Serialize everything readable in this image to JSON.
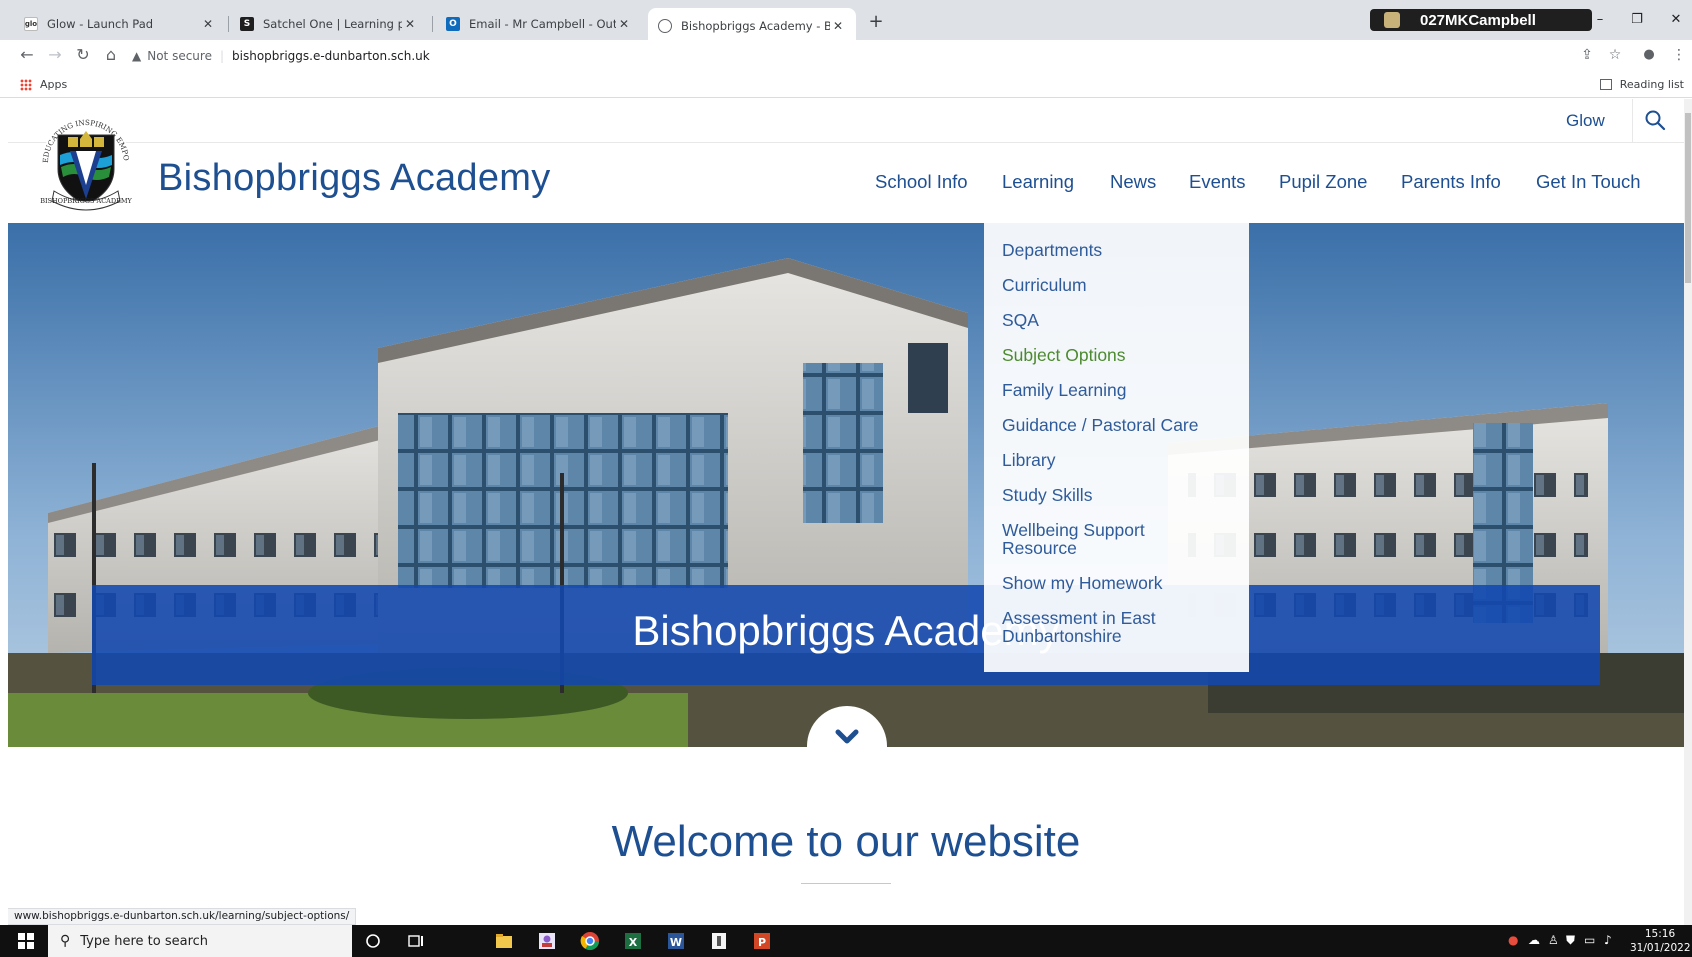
{
  "browser": {
    "tabs": [
      {
        "title": "Glow - Launch Pad",
        "favicon": "glow-icon"
      },
      {
        "title": "Satchel One | Learning platform",
        "favicon": "satchel-icon"
      },
      {
        "title": "Email - Mr Campbell - Outlook",
        "favicon": "outlook-icon"
      },
      {
        "title": "Bishopbriggs Academy - Bishopbr",
        "favicon": "globe-icon",
        "active": true
      }
    ],
    "profile_name": "027MKCampbell",
    "security_label": "Not secure",
    "url": "bishopbriggs.e-dunbarton.sch.uk",
    "bookmarks": {
      "apps_label": "Apps",
      "reading_list_label": "Reading list"
    },
    "status_url": "www.bishopbriggs.e-dunbarton.sch.uk/learning/subject-options/"
  },
  "site": {
    "top_link": "Glow",
    "name": "Bishopbriggs Academy",
    "logo_ring_text": "EDUCATING INSPIRING EMPOWERING",
    "logo_banner_text": "BISHOPBRIGGS ACADEMY",
    "nav": [
      "School Info",
      "Learning",
      "News",
      "Events",
      "Pupil Zone",
      "Parents Info",
      "Get In Touch"
    ],
    "dropdown": {
      "parent": "Learning",
      "items": [
        "Departments",
        "Curriculum",
        "SQA",
        "Subject Options",
        "Family Learning",
        "Guidance / Pastoral Care",
        "Library",
        "Study Skills",
        "Wellbeing Support Resource",
        "Show my Homework",
        "Assessment in East Dunbartonshire"
      ],
      "hovered": "Subject Options"
    },
    "hero_title": "Bishopbriggs Academy",
    "welcome_heading": "Welcome to our website",
    "colors": {
      "brand_blue": "#1d4f91",
      "banner_blue": "#1248af",
      "hover_green": "#4c8a2f"
    }
  },
  "taskbar": {
    "search_placeholder": "Type here to search",
    "time": "15:16",
    "date": "31/01/2022"
  }
}
